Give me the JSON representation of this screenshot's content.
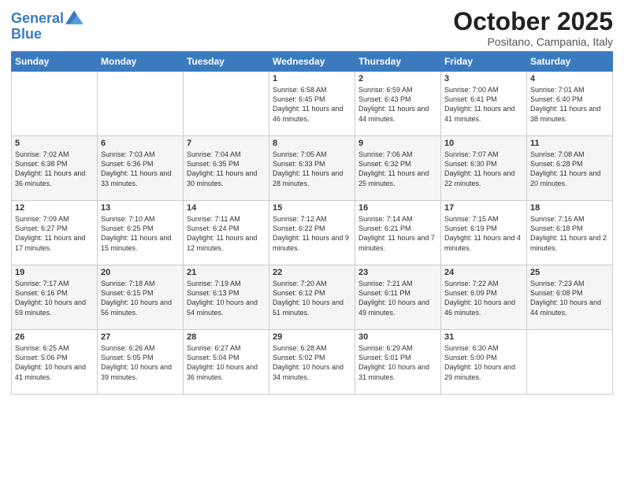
{
  "header": {
    "logo_line1": "General",
    "logo_line2": "Blue",
    "month_title": "October 2025",
    "location": "Positano, Campania, Italy"
  },
  "days_of_week": [
    "Sunday",
    "Monday",
    "Tuesday",
    "Wednesday",
    "Thursday",
    "Friday",
    "Saturday"
  ],
  "weeks": [
    [
      {
        "day": "",
        "text": ""
      },
      {
        "day": "",
        "text": ""
      },
      {
        "day": "",
        "text": ""
      },
      {
        "day": "1",
        "text": "Sunrise: 6:58 AM\nSunset: 6:45 PM\nDaylight: 11 hours\nand 46 minutes."
      },
      {
        "day": "2",
        "text": "Sunrise: 6:59 AM\nSunset: 6:43 PM\nDaylight: 11 hours\nand 44 minutes."
      },
      {
        "day": "3",
        "text": "Sunrise: 7:00 AM\nSunset: 6:41 PM\nDaylight: 11 hours\nand 41 minutes."
      },
      {
        "day": "4",
        "text": "Sunrise: 7:01 AM\nSunset: 6:40 PM\nDaylight: 11 hours\nand 38 minutes."
      }
    ],
    [
      {
        "day": "5",
        "text": "Sunrise: 7:02 AM\nSunset: 6:38 PM\nDaylight: 11 hours\nand 36 minutes."
      },
      {
        "day": "6",
        "text": "Sunrise: 7:03 AM\nSunset: 6:36 PM\nDaylight: 11 hours\nand 33 minutes."
      },
      {
        "day": "7",
        "text": "Sunrise: 7:04 AM\nSunset: 6:35 PM\nDaylight: 11 hours\nand 30 minutes."
      },
      {
        "day": "8",
        "text": "Sunrise: 7:05 AM\nSunset: 6:33 PM\nDaylight: 11 hours\nand 28 minutes."
      },
      {
        "day": "9",
        "text": "Sunrise: 7:06 AM\nSunset: 6:32 PM\nDaylight: 11 hours\nand 25 minutes."
      },
      {
        "day": "10",
        "text": "Sunrise: 7:07 AM\nSunset: 6:30 PM\nDaylight: 11 hours\nand 22 minutes."
      },
      {
        "day": "11",
        "text": "Sunrise: 7:08 AM\nSunset: 6:28 PM\nDaylight: 11 hours\nand 20 minutes."
      }
    ],
    [
      {
        "day": "12",
        "text": "Sunrise: 7:09 AM\nSunset: 6:27 PM\nDaylight: 11 hours\nand 17 minutes."
      },
      {
        "day": "13",
        "text": "Sunrise: 7:10 AM\nSunset: 6:25 PM\nDaylight: 11 hours\nand 15 minutes."
      },
      {
        "day": "14",
        "text": "Sunrise: 7:11 AM\nSunset: 6:24 PM\nDaylight: 11 hours\nand 12 minutes."
      },
      {
        "day": "15",
        "text": "Sunrise: 7:12 AM\nSunset: 6:22 PM\nDaylight: 11 hours\nand 9 minutes."
      },
      {
        "day": "16",
        "text": "Sunrise: 7:14 AM\nSunset: 6:21 PM\nDaylight: 11 hours\nand 7 minutes."
      },
      {
        "day": "17",
        "text": "Sunrise: 7:15 AM\nSunset: 6:19 PM\nDaylight: 11 hours\nand 4 minutes."
      },
      {
        "day": "18",
        "text": "Sunrise: 7:16 AM\nSunset: 6:18 PM\nDaylight: 11 hours\nand 2 minutes."
      }
    ],
    [
      {
        "day": "19",
        "text": "Sunrise: 7:17 AM\nSunset: 6:16 PM\nDaylight: 10 hours\nand 59 minutes."
      },
      {
        "day": "20",
        "text": "Sunrise: 7:18 AM\nSunset: 6:15 PM\nDaylight: 10 hours\nand 56 minutes."
      },
      {
        "day": "21",
        "text": "Sunrise: 7:19 AM\nSunset: 6:13 PM\nDaylight: 10 hours\nand 54 minutes."
      },
      {
        "day": "22",
        "text": "Sunrise: 7:20 AM\nSunset: 6:12 PM\nDaylight: 10 hours\nand 51 minutes."
      },
      {
        "day": "23",
        "text": "Sunrise: 7:21 AM\nSunset: 6:11 PM\nDaylight: 10 hours\nand 49 minutes."
      },
      {
        "day": "24",
        "text": "Sunrise: 7:22 AM\nSunset: 6:09 PM\nDaylight: 10 hours\nand 46 minutes."
      },
      {
        "day": "25",
        "text": "Sunrise: 7:23 AM\nSunset: 6:08 PM\nDaylight: 10 hours\nand 44 minutes."
      }
    ],
    [
      {
        "day": "26",
        "text": "Sunrise: 6:25 AM\nSunset: 5:06 PM\nDaylight: 10 hours\nand 41 minutes."
      },
      {
        "day": "27",
        "text": "Sunrise: 6:26 AM\nSunset: 5:05 PM\nDaylight: 10 hours\nand 39 minutes."
      },
      {
        "day": "28",
        "text": "Sunrise: 6:27 AM\nSunset: 5:04 PM\nDaylight: 10 hours\nand 36 minutes."
      },
      {
        "day": "29",
        "text": "Sunrise: 6:28 AM\nSunset: 5:02 PM\nDaylight: 10 hours\nand 34 minutes."
      },
      {
        "day": "30",
        "text": "Sunrise: 6:29 AM\nSunset: 5:01 PM\nDaylight: 10 hours\nand 31 minutes."
      },
      {
        "day": "31",
        "text": "Sunrise: 6:30 AM\nSunset: 5:00 PM\nDaylight: 10 hours\nand 29 minutes."
      },
      {
        "day": "",
        "text": ""
      }
    ]
  ]
}
